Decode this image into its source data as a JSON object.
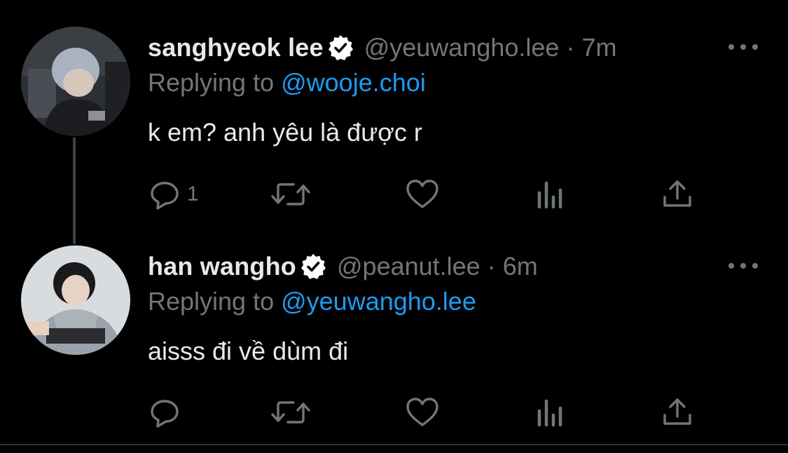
{
  "tweets": [
    {
      "name": "sanghyeok lee",
      "handle": "@yeuwangho.lee",
      "separator": "·",
      "time": "7m",
      "replying_prefix": "Replying to ",
      "replying_to": "@wooje.choi",
      "text": "k em? anh yêu là được r",
      "actions": {
        "reply_count": "1",
        "retweet_count": "",
        "like_count": ""
      }
    },
    {
      "name": "han wangho",
      "handle": "@peanut.lee",
      "separator": "·",
      "time": "6m",
      "replying_prefix": "Replying to ",
      "replying_to": "@yeuwangho.lee",
      "text": "aisss đi về dùm đi",
      "actions": {
        "reply_count": "",
        "retweet_count": "",
        "like_count": ""
      }
    }
  ],
  "icons": {
    "verified": "verified-badge-icon",
    "more": "more-dots-icon",
    "reply": "reply-bubble-icon",
    "retweet": "retweet-icon",
    "like": "heart-icon",
    "views": "analytics-bars-icon",
    "share": "share-upload-icon"
  },
  "colors": {
    "background": "#000000",
    "primary_text": "#e7e9ea",
    "secondary_text": "#71767b",
    "mention": "#1d9bf0",
    "thread_line": "#3d4145"
  }
}
